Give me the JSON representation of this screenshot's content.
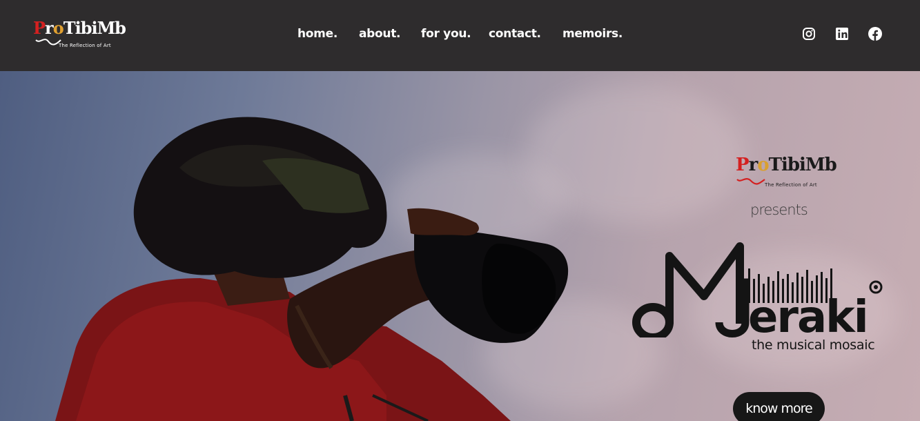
{
  "brand": {
    "logo_text": "ProTibiMb",
    "logo_tagline": "The Reflection of Art"
  },
  "nav": {
    "items": [
      {
        "label": "home."
      },
      {
        "label": "about."
      },
      {
        "label": "for you."
      },
      {
        "label": "contact."
      },
      {
        "label": "memoirs."
      }
    ]
  },
  "social": [
    {
      "icon": "instagram-icon"
    },
    {
      "icon": "linkedin-icon"
    },
    {
      "icon": "facebook-icon"
    }
  ],
  "hero": {
    "presents": "presents",
    "title": "Meraki",
    "tagline": "the musical mosaic",
    "cta_label": "know more"
  },
  "colors": {
    "header_bg": "#2e2c2d",
    "accent_red": "#d42020",
    "cta_bg": "#171717"
  }
}
